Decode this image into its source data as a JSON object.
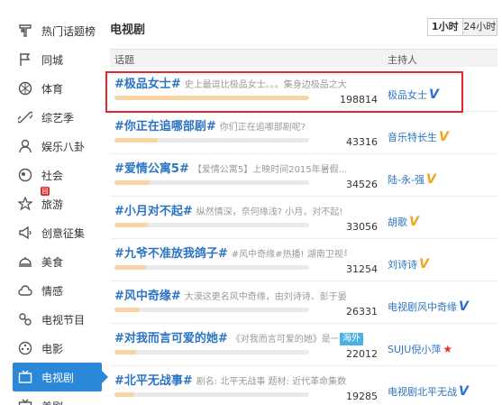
{
  "sidebar": {
    "items": [
      {
        "label": "热门话题榜",
        "icon": "hot-topics-icon",
        "name": "sidebar-item-hot-topics"
      },
      {
        "label": "同城",
        "icon": "flag-icon",
        "name": "sidebar-item-local"
      },
      {
        "label": "体育",
        "icon": "ball-icon",
        "name": "sidebar-item-sports"
      },
      {
        "label": "综艺季",
        "icon": "link-icon",
        "name": "sidebar-item-variety"
      },
      {
        "label": "娱乐八卦",
        "icon": "person-icon",
        "name": "sidebar-item-entertainment"
      },
      {
        "label": "社会",
        "icon": "globe-icon",
        "name": "sidebar-item-society"
      },
      {
        "label": "旅游",
        "icon": "star-icon",
        "name": "sidebar-item-travel",
        "badge": "回"
      },
      {
        "label": "创意征集",
        "icon": "megaphone-icon",
        "name": "sidebar-item-ideas"
      },
      {
        "label": "美食",
        "icon": "dish-icon",
        "name": "sidebar-item-food"
      },
      {
        "label": "情感",
        "icon": "cloud-icon",
        "name": "sidebar-item-emotion"
      },
      {
        "label": "电视节目",
        "icon": "tv-program-icon",
        "name": "sidebar-item-tv-programs"
      },
      {
        "label": "电影",
        "icon": "film-reel-icon",
        "name": "sidebar-item-movies"
      },
      {
        "label": "电视剧",
        "icon": "tv-icon",
        "name": "sidebar-item-tv-dramas",
        "active": true
      },
      {
        "label": "美剧",
        "icon": "tv-icon",
        "name": "sidebar-item-us-dramas"
      }
    ]
  },
  "main": {
    "title": "电视剧",
    "tabs": [
      {
        "label": "1小时",
        "active": true
      },
      {
        "label": "24小时",
        "active": false
      }
    ],
    "columns": {
      "topic": "话题",
      "host": "主持人"
    },
    "rows": [
      {
        "topic": "#极品女士#",
        "desc": "史上最逗比极品女士。。。集身边极品之大成...",
        "count": "198814",
        "progress": 1.0,
        "host": "极品女士",
        "badge": "V-blue",
        "highlighted": true
      },
      {
        "topic": "#你正在追哪部剧#",
        "desc": "你们正在追哪部剧呢?",
        "count": "43316",
        "progress": 0.22,
        "host": "音乐特长生",
        "badge": "V-gold"
      },
      {
        "topic": "#爱情公寓5#",
        "desc": "【爱情公寓5】上映时间2015年暑假...",
        "count": "34526",
        "progress": 0.18,
        "host": "陆-永-强",
        "badge": "V-gold"
      },
      {
        "topic": "#小月对不起#",
        "desc": "纵然情深，奈何缘浅? 小月，对不起!",
        "count": "33056",
        "progress": 0.17,
        "host": "胡歌",
        "badge": "V-gold"
      },
      {
        "topic": "#九爷不准放我鸽子#",
        "desc": "#风中奇缘#热播! 湖南卫视与微...",
        "count": "31254",
        "progress": 0.16,
        "host": "刘诗诗",
        "badge": "V-gold"
      },
      {
        "topic": "#风中奇缘#",
        "desc": "大漠这更名风中奇缘，由刘诗诗、彭于晏、胡...",
        "count": "26331",
        "progress": 0.13,
        "host": "电视剧风中奇缘",
        "badge": "V-blue"
      },
      {
        "topic": "#对我而言可爱的她#",
        "desc": "《对我而言可爱的她》是一部...",
        "count": "22012",
        "progress": 0.11,
        "host": "SUJU倪小萍",
        "badge": "star",
        "tag": "海外"
      },
      {
        "topic": "#北平无战事#",
        "desc": "剧名: 北平无战事 题材: 近代革命集数:...",
        "count": "19285",
        "progress": 0.1,
        "host": "电视剧北平无战",
        "badge": "V-blue"
      }
    ]
  }
}
